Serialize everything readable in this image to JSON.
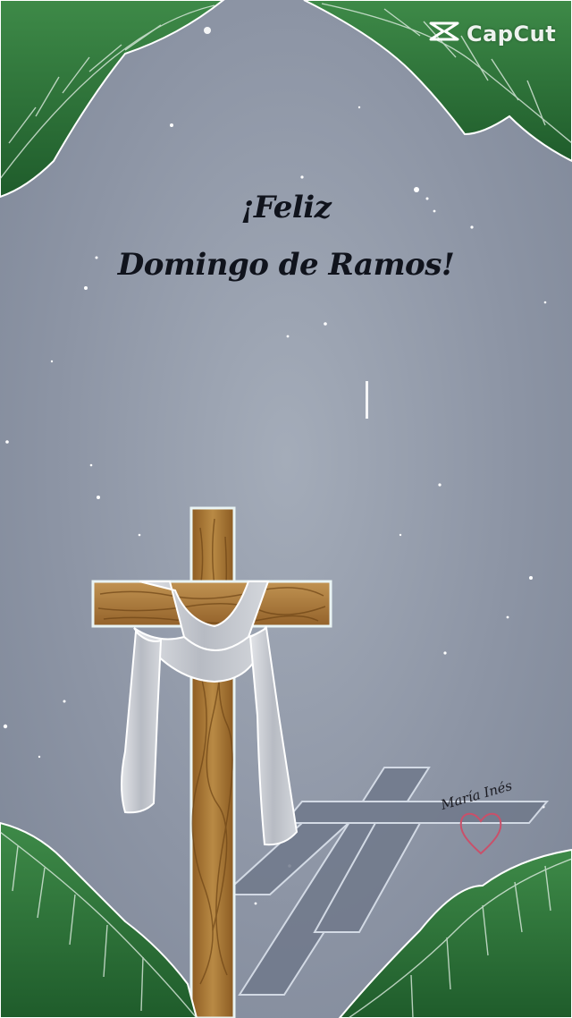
{
  "watermark": {
    "brand": "CapCut",
    "icon": "capcut-logo-icon"
  },
  "greeting": {
    "line1": "¡Feliz",
    "line2": "Domingo de Ramos!"
  },
  "signature": {
    "name": "María Inés",
    "icon": "heart-outline-icon"
  },
  "illustration": {
    "main_subject": "wooden-cross-with-shroud",
    "background": "starry-sky",
    "frame": "palm-fronds"
  },
  "colors": {
    "sky": "#8d95a5",
    "text": "#10131c",
    "wood": "#a9772f",
    "cloth": "#c9ccd2",
    "palm": "#2e7a3b",
    "heart": "#c9506a"
  }
}
